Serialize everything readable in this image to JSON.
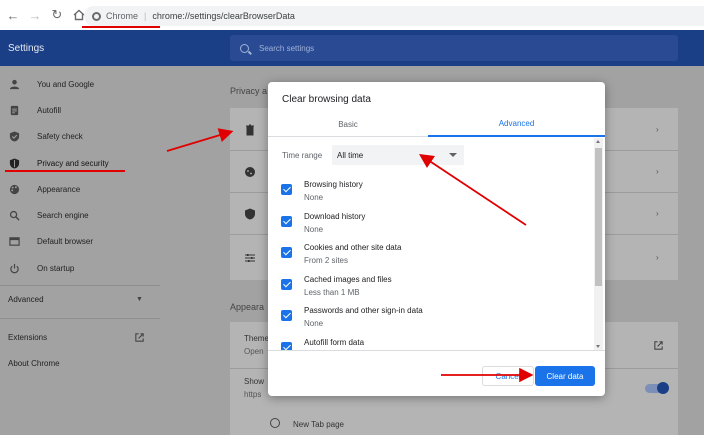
{
  "browser": {
    "chrome_label": "Chrome",
    "url": "chrome://settings/clearBrowserData"
  },
  "header": {
    "title": "Settings",
    "search_placeholder": "Search settings"
  },
  "sidebar": {
    "items": [
      {
        "label": "You and Google",
        "icon": "person-icon"
      },
      {
        "label": "Autofill",
        "icon": "clipboard-icon"
      },
      {
        "label": "Safety check",
        "icon": "shield-check-icon"
      },
      {
        "label": "Privacy and security",
        "icon": "shield-icon"
      },
      {
        "label": "Appearance",
        "icon": "palette-icon"
      },
      {
        "label": "Search engine",
        "icon": "search-icon"
      },
      {
        "label": "Default browser",
        "icon": "browser-icon"
      },
      {
        "label": "On startup",
        "icon": "power-icon"
      }
    ],
    "advanced": "Advanced",
    "extensions": "Extensions",
    "about": "About Chrome"
  },
  "main": {
    "privacy_section": "Privacy a",
    "appearance_section": "Appeara",
    "theme_label": "Theme",
    "theme_sub": "Open",
    "show_label": "Show",
    "show_sub": "https",
    "new_tab": "New Tab page"
  },
  "dialog": {
    "title": "Clear browsing data",
    "tab_basic": "Basic",
    "tab_advanced": "Advanced",
    "time_range_label": "Time range",
    "time_range_value": "All time",
    "items": [
      {
        "label": "Browsing history",
        "sub": "None"
      },
      {
        "label": "Download history",
        "sub": "None"
      },
      {
        "label": "Cookies and other site data",
        "sub": "From 2 sites"
      },
      {
        "label": "Cached images and files",
        "sub": "Less than 1 MB"
      },
      {
        "label": "Passwords and other sign-in data",
        "sub": "None"
      },
      {
        "label": "Autofill form data",
        "sub": ""
      }
    ],
    "cancel": "Cancel",
    "clear": "Clear data"
  },
  "colors": {
    "header_bg": "#1a3f86",
    "accent": "#1a73e8",
    "annotation_red": "#e00000"
  }
}
